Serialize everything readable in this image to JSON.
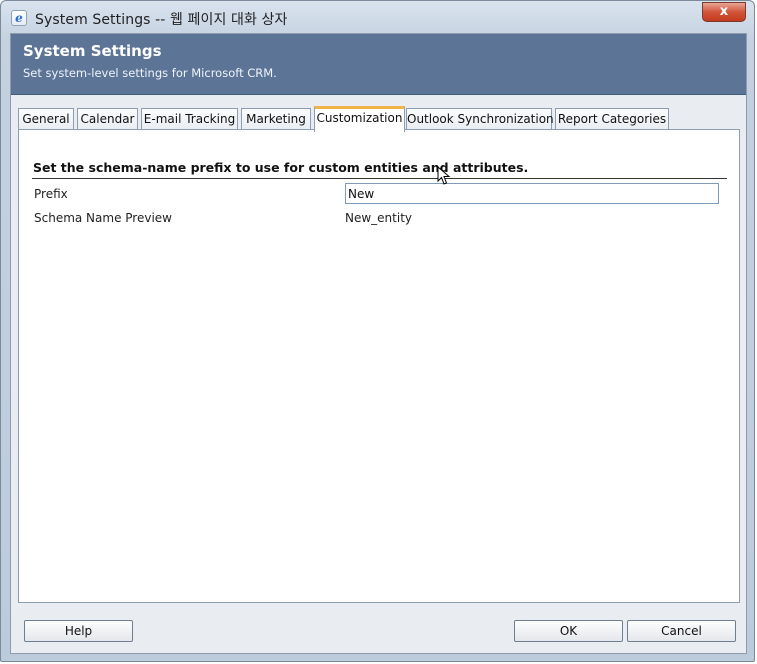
{
  "window": {
    "title": "System Settings -- 웹 페이지 대화 상자",
    "app_icon": "e",
    "close_glyph": "x"
  },
  "header": {
    "title": "System Settings",
    "subtitle": "Set system-level settings for Microsoft CRM."
  },
  "tabs": [
    {
      "label": "General",
      "active": false
    },
    {
      "label": "Calendar",
      "active": false
    },
    {
      "label": "E-mail Tracking",
      "active": false
    },
    {
      "label": "Marketing",
      "active": false
    },
    {
      "label": "Customization",
      "active": true
    },
    {
      "label": "Outlook Synchronization",
      "active": false
    },
    {
      "label": "Report Categories",
      "active": false
    }
  ],
  "customization": {
    "section_title": "Set the schema-name prefix to use for custom entities and attributes.",
    "prefix_label": "Prefix",
    "prefix_value": "New",
    "preview_label": "Schema Name Preview",
    "preview_value": "New_entity"
  },
  "footer": {
    "help_label": "Help",
    "ok_label": "OK",
    "cancel_label": "Cancel"
  },
  "colors": {
    "header_bg": "#5c7597",
    "active_tab_accent": "#f0b448",
    "close_button": "#c43a1d"
  }
}
